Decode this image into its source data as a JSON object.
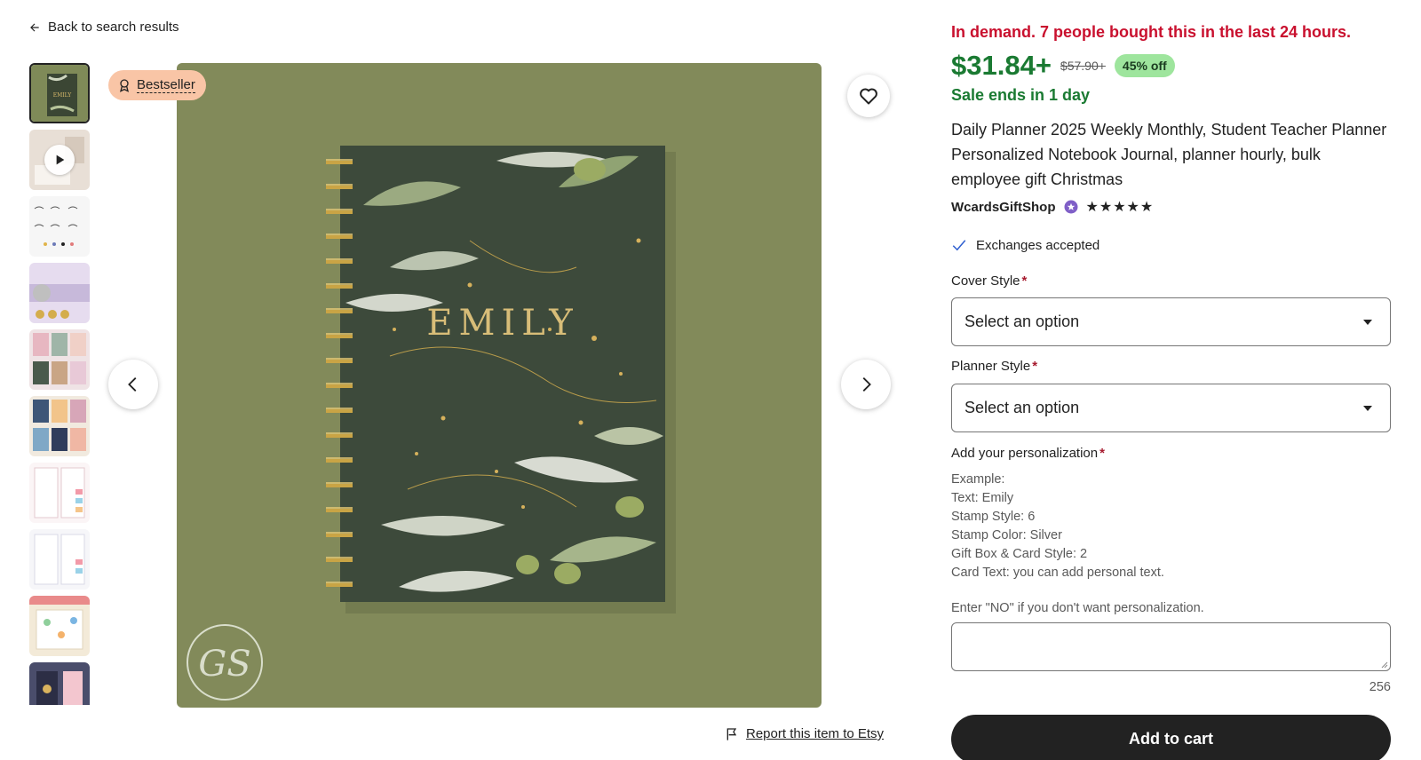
{
  "nav": {
    "back_label": "Back to search results"
  },
  "gallery": {
    "bestseller_label": "Bestseller",
    "report_label": "Report this item to Etsy",
    "main_image": {
      "cover_name": "EMILY",
      "watermark": "GS"
    },
    "thumbnails": [
      {
        "kind": "image",
        "bg": "#5d6b44"
      },
      {
        "kind": "video",
        "bg": "#e8dfd6"
      },
      {
        "kind": "image",
        "bg": "#f4f4f4"
      },
      {
        "kind": "image",
        "bg": "#d9cde6"
      },
      {
        "kind": "image",
        "bg": "#e7d7da"
      },
      {
        "kind": "image",
        "bg": "#c7d1df"
      },
      {
        "kind": "image",
        "bg": "#f6eef0"
      },
      {
        "kind": "image",
        "bg": "#f2f2f5"
      },
      {
        "kind": "image",
        "bg": "#efe6d3"
      },
      {
        "kind": "image",
        "bg": "#4a4d6b"
      }
    ]
  },
  "listing": {
    "demand_text": "In demand. 7 people bought this in the last 24 hours.",
    "price": "$31.84+",
    "original_price": "$57.90+",
    "discount": "45% off",
    "sale_ends": "Sale ends in 1 day",
    "title": "Daily Planner 2025 Weekly Monthly, Student Teacher Planner Personalized Notebook Journal, planner hourly, bulk employee gift Christmas",
    "shop_name": "WcardsGiftShop",
    "rating_stars": "★★★★★",
    "rating_value": 5,
    "exchanges": "Exchanges accepted"
  },
  "options": {
    "cover_style_label": "Cover Style",
    "cover_style_value": "Select an option",
    "planner_style_label": "Planner Style",
    "planner_style_value": "Select an option",
    "required_mark": "*"
  },
  "personalization": {
    "label": "Add your personalization",
    "example_lines": [
      "Example:",
      "Text: Emily",
      "Stamp Style: 6",
      "Stamp Color: Silver",
      "Gift Box & Card Style: 2",
      "Card Text: you can add personal text."
    ],
    "instruction": "Enter \"NO\" if you don't want personalization.",
    "value": "",
    "counter": "256"
  },
  "actions": {
    "add_to_cart": "Add to cart"
  },
  "colors": {
    "demand": "#c9102e",
    "price": "#1a7a32",
    "discount_bg": "#9ee59d",
    "bestseller_bg": "#f9c5a6",
    "cart_bg": "#222222"
  }
}
